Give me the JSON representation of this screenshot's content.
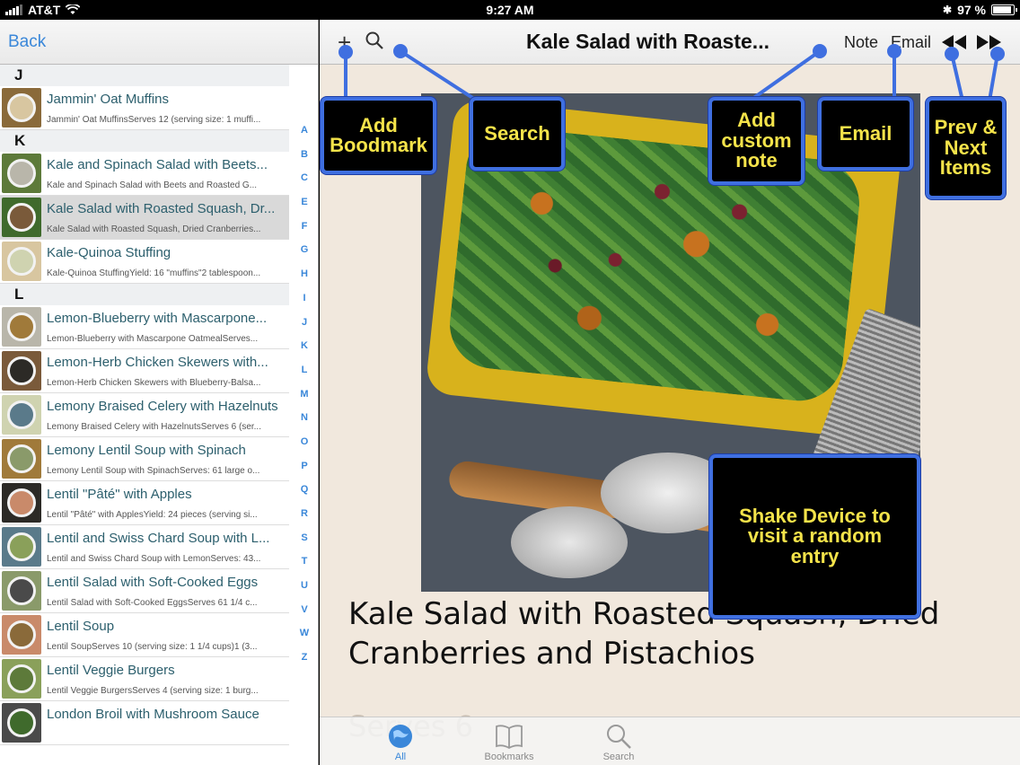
{
  "status": {
    "carrier": "AT&T",
    "time": "9:27 AM",
    "battery": "97 %",
    "battery_level": 0.97
  },
  "sidebar": {
    "back_label": "Back",
    "sections": [
      {
        "letter": "J",
        "rows": [
          {
            "title": "Jammin' Oat Muffins",
            "subtitle": "Jammin' Oat MuffinsServes 12 (serving size: 1 muffi..."
          }
        ]
      },
      {
        "letter": "K",
        "rows": [
          {
            "title": "Kale and Spinach Salad with Beets...",
            "subtitle": "Kale and Spinach Salad with Beets and Roasted G..."
          },
          {
            "title": "Kale Salad with Roasted Squash, Dr...",
            "subtitle": "Kale Salad with Roasted Squash, Dried Cranberries...",
            "selected": true
          },
          {
            "title": "Kale-Quinoa Stuffing",
            "subtitle": "Kale-Quinoa StuffingYield: 16 \"muffins\"2 tablespoon..."
          }
        ]
      },
      {
        "letter": "L",
        "rows": [
          {
            "title": "Lemon-Blueberry with Mascarpone...",
            "subtitle": "Lemon-Blueberry with Mascarpone OatmealServes..."
          },
          {
            "title": "Lemon-Herb Chicken Skewers with...",
            "subtitle": "Lemon-Herb Chicken Skewers with Blueberry-Balsa..."
          },
          {
            "title": "Lemony Braised Celery with Hazelnuts",
            "subtitle": "Lemony Braised Celery with HazelnutsServes 6 (ser..."
          },
          {
            "title": "Lemony Lentil Soup with Spinach",
            "subtitle": "Lemony Lentil Soup with SpinachServes: 61 large o..."
          },
          {
            "title": "Lentil \"Pâté\" with Apples",
            "subtitle": "Lentil \"Pâté\" with ApplesYield: 24 pieces (serving si..."
          },
          {
            "title": "Lentil and Swiss Chard Soup with L...",
            "subtitle": "Lentil and Swiss Chard Soup with LemonServes: 43..."
          },
          {
            "title": "Lentil Salad with Soft-Cooked Eggs",
            "subtitle": "Lentil Salad with Soft-Cooked EggsServes 61 1/4 c..."
          },
          {
            "title": "Lentil Soup",
            "subtitle": "Lentil SoupServes 10 (serving size: 1 1/4 cups)1 (3..."
          },
          {
            "title": "Lentil Veggie Burgers",
            "subtitle": "Lentil Veggie BurgersServes 4 (serving size: 1 burg..."
          },
          {
            "title": "London Broil with Mushroom Sauce",
            "subtitle": ""
          }
        ]
      }
    ],
    "alphabet": [
      "A",
      "B",
      "C",
      "E",
      "F",
      "G",
      "H",
      "I",
      "J",
      "K",
      "L",
      "M",
      "N",
      "O",
      "P",
      "Q",
      "R",
      "S",
      "T",
      "U",
      "V",
      "W",
      "Z"
    ]
  },
  "toolbar": {
    "title": "Kale Salad with Roaste...",
    "note_label": "Note",
    "email_label": "Email"
  },
  "detail": {
    "title": "Kale Salad with Roasted Squash, Dried Cranberries and Pistachios",
    "serves": "Serves 6"
  },
  "callouts": {
    "bookmark": "Add Boodmark",
    "search": "Search",
    "note": "Add custom note",
    "email": "Email",
    "prevnext": "Prev & Next Items",
    "shake": "Shake Device to visit a random entry"
  },
  "tabs": [
    {
      "label": "All",
      "icon": "globe-icon",
      "active": true
    },
    {
      "label": "Bookmarks",
      "icon": "book-icon",
      "active": false
    },
    {
      "label": "Search",
      "icon": "search-icon",
      "active": false
    }
  ],
  "colors": {
    "accent": "#3a87d9",
    "callout_border": "#3f6fe0",
    "callout_text": "#f4e34a"
  }
}
